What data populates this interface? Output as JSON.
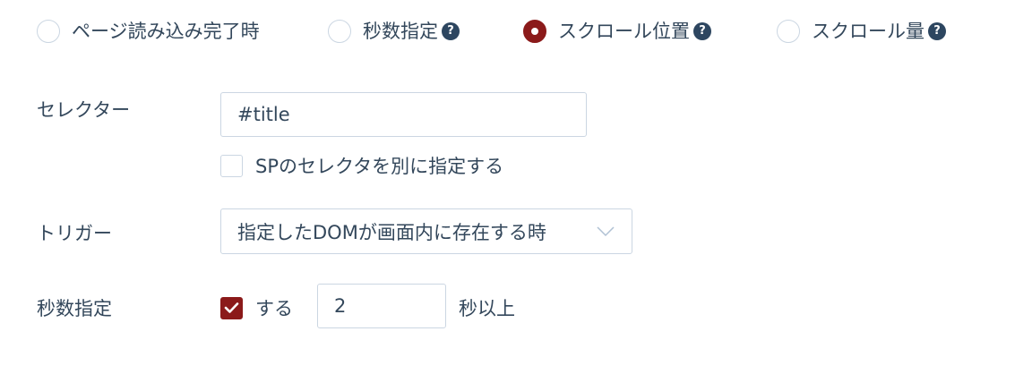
{
  "trigger_type": {
    "options": [
      {
        "label": "ページ読み込み完了時",
        "checked": false,
        "help": false
      },
      {
        "label": "秒数指定",
        "checked": false,
        "help": true
      },
      {
        "label": "スクロール位置",
        "checked": true,
        "help": true
      },
      {
        "label": "スクロール量",
        "checked": false,
        "help": true
      }
    ],
    "help_glyph": "?"
  },
  "selector": {
    "label": "セレクター",
    "value": "#title",
    "sp_checkbox": {
      "label": "SPのセレクタを別に指定する",
      "checked": false
    }
  },
  "trigger": {
    "label": "トリガー",
    "selected": "指定したDOMが画面内に存在する時"
  },
  "seconds": {
    "label": "秒数指定",
    "checkbox": {
      "label": "する",
      "checked": true
    },
    "value": "2",
    "suffix": "秒以上"
  },
  "colors": {
    "accent": "#8b1a1a",
    "text": "#33475b",
    "border": "#cbd6e2",
    "help_icon": "#2d4660"
  }
}
